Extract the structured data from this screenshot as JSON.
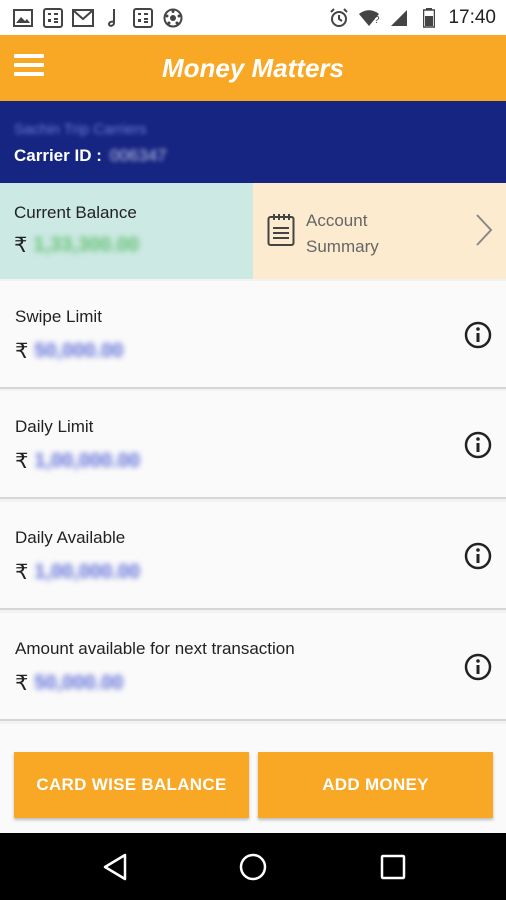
{
  "status_bar": {
    "time": "17:40",
    "icons": [
      "image-icon",
      "calculator-icon",
      "gmail-icon",
      "music-icon",
      "calculator-icon",
      "soccer-ball-icon",
      "alarm-icon",
      "wifi-icon",
      "signal-icon",
      "battery-icon"
    ]
  },
  "app_bar": {
    "title": "Money Matters",
    "menu_icon": "hamburger-menu-icon"
  },
  "user": {
    "name": "Sachin Trip Carriers",
    "carrier_label": "Carrier ID :",
    "carrier_id": "006347"
  },
  "balance": {
    "label": "Current Balance",
    "currency": "₹",
    "value": "1,33,300.00"
  },
  "account_summary": {
    "label": "Account\nSummary",
    "icon": "notepad-icon"
  },
  "limits": [
    {
      "label": "Swipe Limit",
      "currency": "₹",
      "value": "50,000.00"
    },
    {
      "label": "Daily Limit",
      "currency": "₹",
      "value": "1,00,000.00"
    },
    {
      "label": "Daily Available",
      "currency": "₹",
      "value": "1,00,000.00"
    },
    {
      "label": "Amount available for next transaction",
      "currency": "₹",
      "value": "50,000.00"
    }
  ],
  "buttons": {
    "card_wise_balance": "CARD WISE BALANCE",
    "add_money": "ADD MONEY"
  },
  "colors": {
    "primary": "#f9a825",
    "navy": "#172582",
    "balance_bg": "#cce9e3",
    "summary_bg": "#fdebcf"
  }
}
